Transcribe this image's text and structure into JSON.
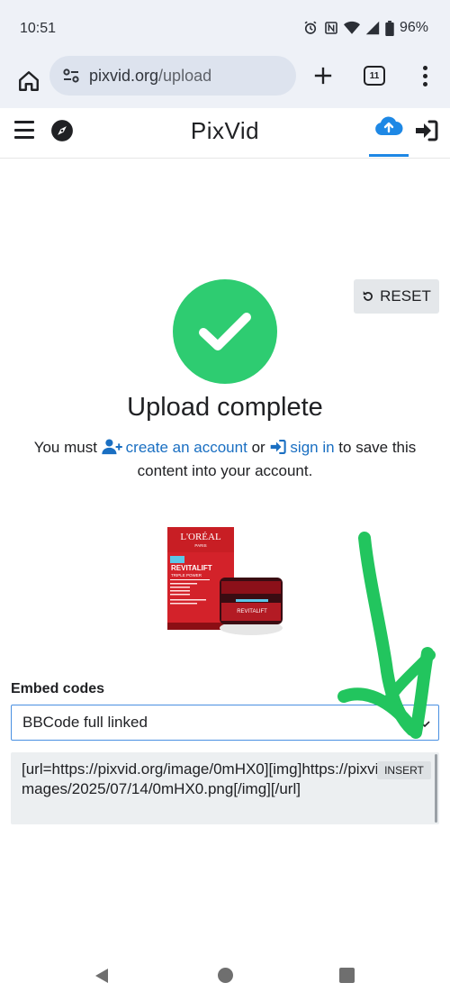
{
  "status_bar": {
    "time": "10:51",
    "battery": "96%",
    "icons": [
      "alarm-icon",
      "nfc-icon",
      "wifi-icon",
      "signal-icon",
      "battery-icon"
    ]
  },
  "browser": {
    "url_domain": "pixvid.org",
    "url_path": "/upload",
    "tab_count": "11"
  },
  "site": {
    "title": "PixVid",
    "accent_color": "#1e88e5"
  },
  "reset_label": "RESET",
  "upload": {
    "title": "Upload complete",
    "msg_prefix": "You must",
    "create_account": "create an account",
    "or": "or",
    "sign_in": "sign in",
    "msg_suffix": "to save this content into your account.",
    "success_color": "#2ecc71"
  },
  "product_image": {
    "brand": "L'ORÉAL",
    "sub": "PARIS",
    "line": "REVITALIFT",
    "variant": "TRIPLE POWER"
  },
  "embed": {
    "label": "Embed codes",
    "selected": "BBCode full linked",
    "code": "[url=https://pixvid.org/image/0mHX0][img]https://pixvid.org/images/2025/07/14/0mHX0.png[/img][/url]",
    "insert_label": "INSERT"
  }
}
